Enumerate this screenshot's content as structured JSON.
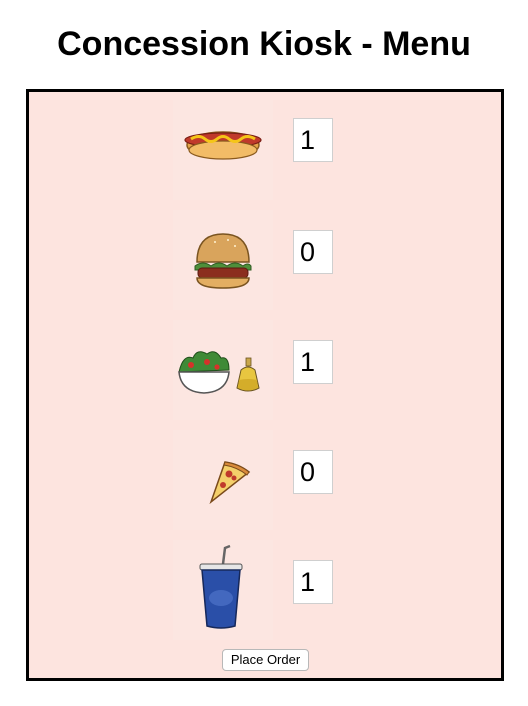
{
  "page": {
    "title": "Concession Kiosk - Menu"
  },
  "menu": {
    "items": [
      {
        "icon": "hot-dog-icon",
        "quantity": "1"
      },
      {
        "icon": "burger-icon",
        "quantity": "0"
      },
      {
        "icon": "salad-with-dressing-icon",
        "quantity": "1"
      },
      {
        "icon": "pizza-slice-icon",
        "quantity": "0"
      },
      {
        "icon": "soda-cup-icon",
        "quantity": "1"
      }
    ],
    "place_order_label": "Place Order"
  },
  "colors": {
    "panel_background": "#fde4df",
    "panel_border": "#000000"
  }
}
